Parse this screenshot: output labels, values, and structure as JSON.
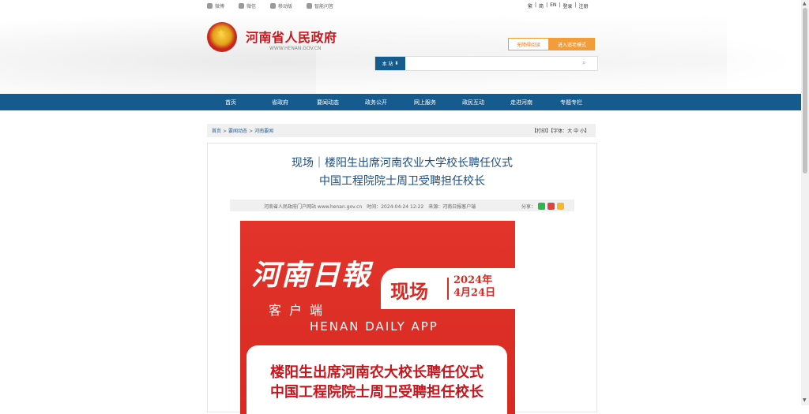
{
  "topbar": {
    "left_items": [
      "微博",
      "微信",
      "移动版",
      "智能问答"
    ],
    "right_links": [
      "繁",
      "简",
      "EN",
      "登录",
      "注册"
    ]
  },
  "header": {
    "site_title": "河南省人民政府",
    "site_url": "WWW.HENAN.GOV.CN",
    "barrier_free": "无障碍阅读",
    "elder_mode": "进入适老模式",
    "search_scope": "本 站",
    "search_placeholder": ""
  },
  "nav": {
    "items": [
      "首页",
      "省政府",
      "要闻动态",
      "政务公开",
      "网上服务",
      "政民互动",
      "走进河南",
      "专题专栏"
    ]
  },
  "breadcrumb": {
    "home": "首页",
    "level1": "要闻动态",
    "level2": "河南要闻",
    "tools": "【打印】【字体：大 中 小】"
  },
  "article": {
    "title_line1": "现场｜楼阳生出席河南农业大学校长聘任仪式",
    "title_line2": "中国工程院院士周卫受聘担任校长",
    "meta_source": "河南省人民政府门户网站 www.henan.gov.cn　时间：2024-04-24 12:22　来源：河南日报客户端",
    "share_label": "分享："
  },
  "hero": {
    "brand": "河南日報",
    "scene": "现场",
    "date": "2024年\n4月24日",
    "client": "客户端",
    "app": "HENAN DAILY APP",
    "line1": "楼阳生出席河南农大校长聘任仪式",
    "line2": "中国工程院院士周卫受聘担任校长"
  },
  "colors": {
    "nav_blue": "#165b8e",
    "brand_red": "#c8161d",
    "accent_orange": "#f39c3a",
    "title_blue": "#1b4e86"
  }
}
